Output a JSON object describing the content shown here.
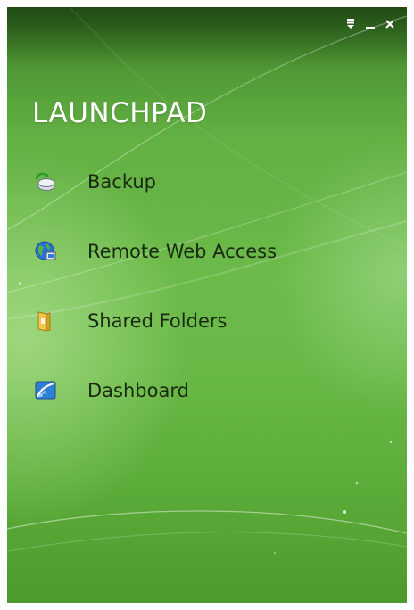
{
  "app": {
    "title": "LAUNCHPAD"
  },
  "window_controls": [
    {
      "name": "pin-icon"
    },
    {
      "name": "minimize-icon"
    },
    {
      "name": "close-icon"
    }
  ],
  "menu": {
    "items": [
      {
        "label": "Backup",
        "icon": "backup-icon"
      },
      {
        "label": "Remote Web Access",
        "icon": "globe-icon"
      },
      {
        "label": "Shared Folders",
        "icon": "folder-icon"
      },
      {
        "label": "Dashboard",
        "icon": "dashboard-icon"
      }
    ]
  },
  "colors": {
    "background_top": "#2f6a20",
    "background_mid": "#6cba4a",
    "title_text": "#ffffff",
    "item_text": "#1a2a12"
  }
}
